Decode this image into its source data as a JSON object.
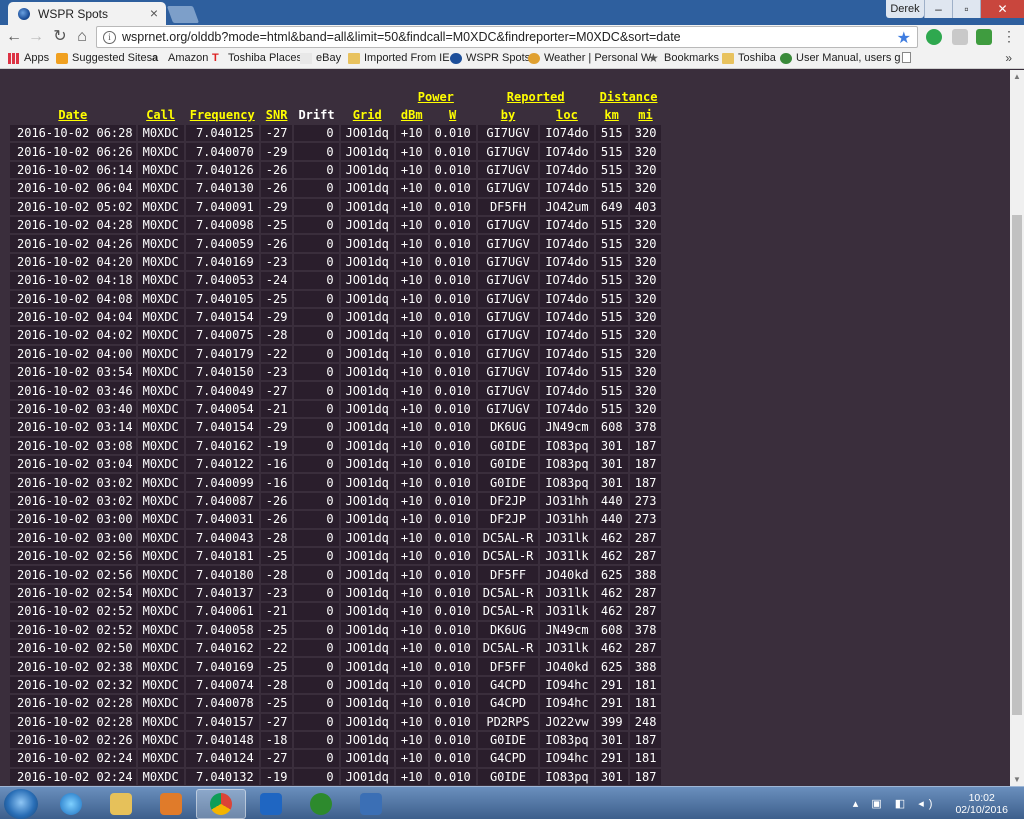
{
  "browser": {
    "tab_title": "WSPR Spots",
    "profile_name": "Derek",
    "url": "wsprnet.org/olddb?mode=html&band=all&limit=50&findcall=M0XDC&findreporter=M0XDC&sort=date"
  },
  "bookmarks": {
    "apps": "Apps",
    "items": [
      "Suggested Sites",
      "Amazon",
      "Toshiba Places",
      "eBay",
      "Imported From IE",
      "WSPR Spots",
      "Weather | Personal W",
      "Bookmarks",
      "Toshiba",
      "User Manual, users g"
    ],
    "more": "»"
  },
  "table": {
    "group_headers": {
      "power": "Power",
      "reported": "Reported",
      "distance": "Distance"
    },
    "headers": {
      "date": "Date",
      "call": "Call",
      "frequency": "Frequency",
      "snr": "SNR",
      "drift": "Drift",
      "grid": "Grid",
      "dbm": "dBm",
      "w": "W",
      "by": "by",
      "loc": "loc",
      "km": "km",
      "mi": "mi"
    },
    "rows": [
      [
        "2016-10-02 06:28",
        "M0XDC",
        "7.040125",
        "-27",
        "0",
        "JO01dq",
        "+10",
        "0.010",
        "GI7UGV",
        "IO74do",
        "515",
        "320"
      ],
      [
        "2016-10-02 06:26",
        "M0XDC",
        "7.040070",
        "-29",
        "0",
        "JO01dq",
        "+10",
        "0.010",
        "GI7UGV",
        "IO74do",
        "515",
        "320"
      ],
      [
        "2016-10-02 06:14",
        "M0XDC",
        "7.040126",
        "-26",
        "0",
        "JO01dq",
        "+10",
        "0.010",
        "GI7UGV",
        "IO74do",
        "515",
        "320"
      ],
      [
        "2016-10-02 06:04",
        "M0XDC",
        "7.040130",
        "-26",
        "0",
        "JO01dq",
        "+10",
        "0.010",
        "GI7UGV",
        "IO74do",
        "515",
        "320"
      ],
      [
        "2016-10-02 05:02",
        "M0XDC",
        "7.040091",
        "-29",
        "0",
        "JO01dq",
        "+10",
        "0.010",
        "DF5FH",
        "JO42um",
        "649",
        "403"
      ],
      [
        "2016-10-02 04:28",
        "M0XDC",
        "7.040098",
        "-25",
        "0",
        "JO01dq",
        "+10",
        "0.010",
        "GI7UGV",
        "IO74do",
        "515",
        "320"
      ],
      [
        "2016-10-02 04:26",
        "M0XDC",
        "7.040059",
        "-26",
        "0",
        "JO01dq",
        "+10",
        "0.010",
        "GI7UGV",
        "IO74do",
        "515",
        "320"
      ],
      [
        "2016-10-02 04:20",
        "M0XDC",
        "7.040169",
        "-23",
        "0",
        "JO01dq",
        "+10",
        "0.010",
        "GI7UGV",
        "IO74do",
        "515",
        "320"
      ],
      [
        "2016-10-02 04:18",
        "M0XDC",
        "7.040053",
        "-24",
        "0",
        "JO01dq",
        "+10",
        "0.010",
        "GI7UGV",
        "IO74do",
        "515",
        "320"
      ],
      [
        "2016-10-02 04:08",
        "M0XDC",
        "7.040105",
        "-25",
        "0",
        "JO01dq",
        "+10",
        "0.010",
        "GI7UGV",
        "IO74do",
        "515",
        "320"
      ],
      [
        "2016-10-02 04:04",
        "M0XDC",
        "7.040154",
        "-29",
        "0",
        "JO01dq",
        "+10",
        "0.010",
        "GI7UGV",
        "IO74do",
        "515",
        "320"
      ],
      [
        "2016-10-02 04:02",
        "M0XDC",
        "7.040075",
        "-28",
        "0",
        "JO01dq",
        "+10",
        "0.010",
        "GI7UGV",
        "IO74do",
        "515",
        "320"
      ],
      [
        "2016-10-02 04:00",
        "M0XDC",
        "7.040179",
        "-22",
        "0",
        "JO01dq",
        "+10",
        "0.010",
        "GI7UGV",
        "IO74do",
        "515",
        "320"
      ],
      [
        "2016-10-02 03:54",
        "M0XDC",
        "7.040150",
        "-23",
        "0",
        "JO01dq",
        "+10",
        "0.010",
        "GI7UGV",
        "IO74do",
        "515",
        "320"
      ],
      [
        "2016-10-02 03:46",
        "M0XDC",
        "7.040049",
        "-27",
        "0",
        "JO01dq",
        "+10",
        "0.010",
        "GI7UGV",
        "IO74do",
        "515",
        "320"
      ],
      [
        "2016-10-02 03:40",
        "M0XDC",
        "7.040054",
        "-21",
        "0",
        "JO01dq",
        "+10",
        "0.010",
        "GI7UGV",
        "IO74do",
        "515",
        "320"
      ],
      [
        "2016-10-02 03:14",
        "M0XDC",
        "7.040154",
        "-29",
        "0",
        "JO01dq",
        "+10",
        "0.010",
        "DK6UG",
        "JN49cm",
        "608",
        "378"
      ],
      [
        "2016-10-02 03:08",
        "M0XDC",
        "7.040162",
        "-19",
        "0",
        "JO01dq",
        "+10",
        "0.010",
        "G0IDE",
        "IO83pq",
        "301",
        "187"
      ],
      [
        "2016-10-02 03:04",
        "M0XDC",
        "7.040122",
        "-16",
        "0",
        "JO01dq",
        "+10",
        "0.010",
        "G0IDE",
        "IO83pq",
        "301",
        "187"
      ],
      [
        "2016-10-02 03:02",
        "M0XDC",
        "7.040099",
        "-16",
        "0",
        "JO01dq",
        "+10",
        "0.010",
        "G0IDE",
        "IO83pq",
        "301",
        "187"
      ],
      [
        "2016-10-02 03:02",
        "M0XDC",
        "7.040087",
        "-26",
        "0",
        "JO01dq",
        "+10",
        "0.010",
        "DF2JP",
        "JO31hh",
        "440",
        "273"
      ],
      [
        "2016-10-02 03:00",
        "M0XDC",
        "7.040031",
        "-26",
        "0",
        "JO01dq",
        "+10",
        "0.010",
        "DF2JP",
        "JO31hh",
        "440",
        "273"
      ],
      [
        "2016-10-02 03:00",
        "M0XDC",
        "7.040043",
        "-28",
        "0",
        "JO01dq",
        "+10",
        "0.010",
        "DC5AL-R",
        "JO31lk",
        "462",
        "287"
      ],
      [
        "2016-10-02 02:56",
        "M0XDC",
        "7.040181",
        "-25",
        "0",
        "JO01dq",
        "+10",
        "0.010",
        "DC5AL-R",
        "JO31lk",
        "462",
        "287"
      ],
      [
        "2016-10-02 02:56",
        "M0XDC",
        "7.040180",
        "-28",
        "0",
        "JO01dq",
        "+10",
        "0.010",
        "DF5FF",
        "JO40kd",
        "625",
        "388"
      ],
      [
        "2016-10-02 02:54",
        "M0XDC",
        "7.040137",
        "-23",
        "0",
        "JO01dq",
        "+10",
        "0.010",
        "DC5AL-R",
        "JO31lk",
        "462",
        "287"
      ],
      [
        "2016-10-02 02:52",
        "M0XDC",
        "7.040061",
        "-21",
        "0",
        "JO01dq",
        "+10",
        "0.010",
        "DC5AL-R",
        "JO31lk",
        "462",
        "287"
      ],
      [
        "2016-10-02 02:52",
        "M0XDC",
        "7.040058",
        "-25",
        "0",
        "JO01dq",
        "+10",
        "0.010",
        "DK6UG",
        "JN49cm",
        "608",
        "378"
      ],
      [
        "2016-10-02 02:50",
        "M0XDC",
        "7.040162",
        "-22",
        "0",
        "JO01dq",
        "+10",
        "0.010",
        "DC5AL-R",
        "JO31lk",
        "462",
        "287"
      ],
      [
        "2016-10-02 02:38",
        "M0XDC",
        "7.040169",
        "-25",
        "0",
        "JO01dq",
        "+10",
        "0.010",
        "DF5FF",
        "JO40kd",
        "625",
        "388"
      ],
      [
        "2016-10-02 02:32",
        "M0XDC",
        "7.040074",
        "-28",
        "0",
        "JO01dq",
        "+10",
        "0.010",
        "G4CPD",
        "IO94hc",
        "291",
        "181"
      ],
      [
        "2016-10-02 02:28",
        "M0XDC",
        "7.040078",
        "-25",
        "0",
        "JO01dq",
        "+10",
        "0.010",
        "G4CPD",
        "IO94hc",
        "291",
        "181"
      ],
      [
        "2016-10-02 02:28",
        "M0XDC",
        "7.040157",
        "-27",
        "0",
        "JO01dq",
        "+10",
        "0.010",
        "PD2RPS",
        "JO22vw",
        "399",
        "248"
      ],
      [
        "2016-10-02 02:26",
        "M0XDC",
        "7.040148",
        "-18",
        "0",
        "JO01dq",
        "+10",
        "0.010",
        "G0IDE",
        "IO83pq",
        "301",
        "187"
      ],
      [
        "2016-10-02 02:24",
        "M0XDC",
        "7.040124",
        "-27",
        "0",
        "JO01dq",
        "+10",
        "0.010",
        "G4CPD",
        "IO94hc",
        "291",
        "181"
      ],
      [
        "2016-10-02 02:24",
        "M0XDC",
        "7.040132",
        "-19",
        "0",
        "JO01dq",
        "+10",
        "0.010",
        "G0IDE",
        "IO83pq",
        "301",
        "187"
      ]
    ]
  },
  "taskbar": {
    "time": "10:02",
    "date": "02/10/2016"
  },
  "colors": {
    "page_bg": "#3a2e3c",
    "cell_bg": "#2a1e2c",
    "header_link": "#ffff00"
  }
}
